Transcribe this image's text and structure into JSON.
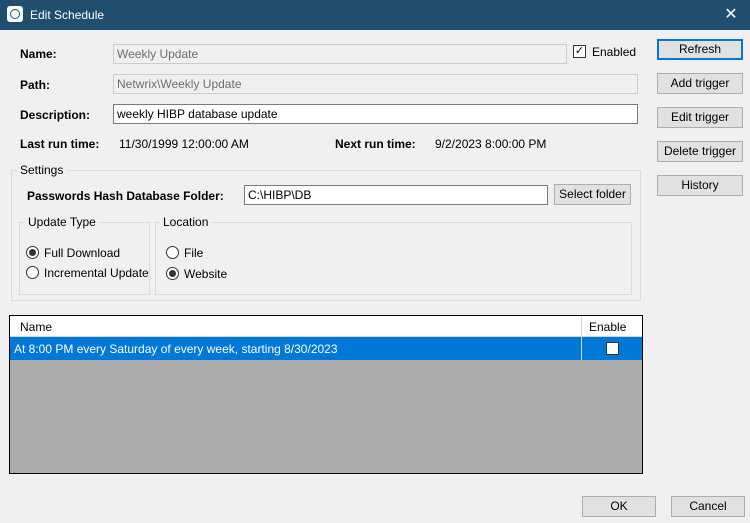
{
  "window": {
    "title": "Edit Schedule",
    "close_glyph": "✕"
  },
  "form": {
    "name_label": "Name:",
    "name_value": "Weekly Update",
    "enabled_label": "Enabled",
    "enabled_checked": true,
    "path_label": "Path:",
    "path_value": "Netwrix\\Weekly Update",
    "description_label": "Description:",
    "description_value": "weekly HIBP database update",
    "last_run_label": "Last run time:",
    "last_run_value": "11/30/1999 12:00:00 AM",
    "next_run_label": "Next run time:",
    "next_run_value": "9/2/2023 8:00:00 PM"
  },
  "buttons": {
    "refresh": "Refresh",
    "add_trigger": "Add trigger",
    "edit_trigger": "Edit trigger",
    "delete_trigger": "Delete trigger",
    "history": "History",
    "select_folder": "Select folder",
    "ok": "OK",
    "cancel": "Cancel"
  },
  "settings": {
    "group_label": "Settings",
    "folder_label": "Passwords Hash Database Folder:",
    "folder_value": "C:\\HIBP\\DB",
    "update_type": {
      "label": "Update Type",
      "options": [
        {
          "label": "Full Download",
          "checked": true
        },
        {
          "label": "Incremental Update",
          "checked": false
        }
      ]
    },
    "location": {
      "label": "Location",
      "options": [
        {
          "label": "File",
          "checked": false
        },
        {
          "label": "Website",
          "checked": true
        }
      ]
    }
  },
  "triggers": {
    "columns": [
      "Name",
      "Enable"
    ],
    "rows": [
      {
        "name": "At 8:00 PM every Saturday of every week, starting 8/30/2023",
        "enabled": true
      }
    ]
  },
  "colors": {
    "titlebar": "#1f4e6e",
    "selection": "#0078d7",
    "grid_empty": "#ababab"
  },
  "icons": {
    "check": "✓",
    "app": "app-icon"
  }
}
